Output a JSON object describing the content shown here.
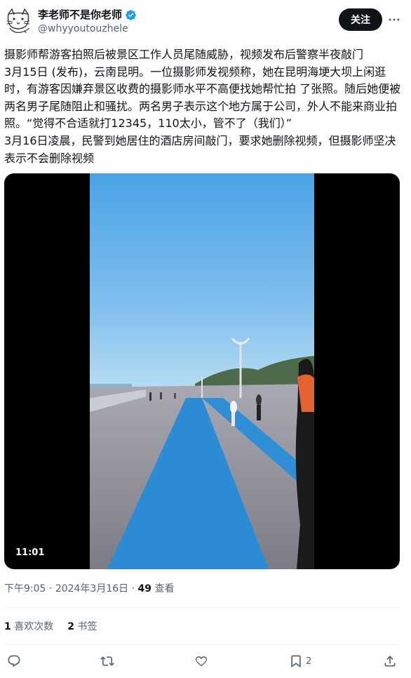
{
  "author": {
    "display_name": "李老师不是你老师",
    "handle": "@whyyoutouzhele",
    "verified_icon": "verified-badge-icon",
    "avatar_icon": "cat-sketch-avatar"
  },
  "header": {
    "follow_label": "关注",
    "more_icon": "more-dots-icon"
  },
  "tweet": {
    "text_lines": [
      "摄影师帮游客拍照后被景区工作人员尾随威胁，视频发布后警察半夜敲门",
      "3月15日 (发布)，云南昆明。一位摄影师发视频称，她在昆明海埂大坝上闲逛时，有游客因嫌弃景区收费的摄影师水平不高便找她帮忙拍 了张照。随后她便被两名男子尾随阻止和骚扰。两名男子表示这个地方属于公司，外人不能来商业拍照。“觉得不合适就打12345，110太小，管不了（我们）”",
      "3月16日凌晨，民警到她居住的酒店房间敲门，要求她删除视频，但摄影师坚决表示不会删除视频"
    ]
  },
  "media": {
    "duration": "11:01"
  },
  "meta": {
    "time": "下午9:05",
    "date": "2024年3月16日",
    "separator": "·",
    "views_count": "49",
    "views_label": "查看"
  },
  "stats": {
    "likes_count": "1",
    "likes_label": "喜欢次数",
    "bookmarks_count": "2",
    "bookmarks_label": "书签"
  },
  "actions": {
    "reply_icon": "reply-icon",
    "retweet_icon": "retweet-icon",
    "like_icon": "heart-icon",
    "bookmark_icon": "bookmark-icon",
    "bookmark_count": "2",
    "share_icon": "share-icon"
  },
  "colors": {
    "text_primary": "#0f1419",
    "text_secondary": "#536471",
    "verified_blue": "#1d9bf0",
    "divider": "#eff3f4",
    "follow_bg": "#0f1419"
  }
}
